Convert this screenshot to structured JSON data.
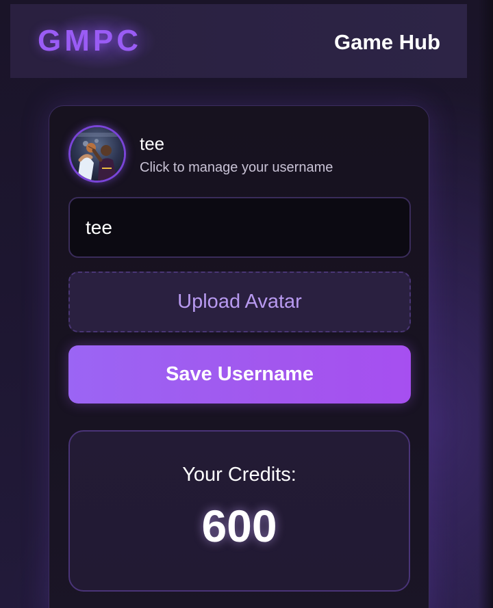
{
  "header": {
    "logo": "GMPC",
    "nav_title": "Game Hub"
  },
  "profile": {
    "username": "tee",
    "hint": "Click to manage your username",
    "avatar_icon": "user-avatar-photo"
  },
  "form": {
    "username_value": "tee",
    "upload_label": "Upload Avatar",
    "save_label": "Save Username"
  },
  "credits": {
    "label": "Your Credits:",
    "value": "600"
  },
  "colors": {
    "accent": "#9a5cf5",
    "button": "#a257ee",
    "background": "#1a1428"
  }
}
